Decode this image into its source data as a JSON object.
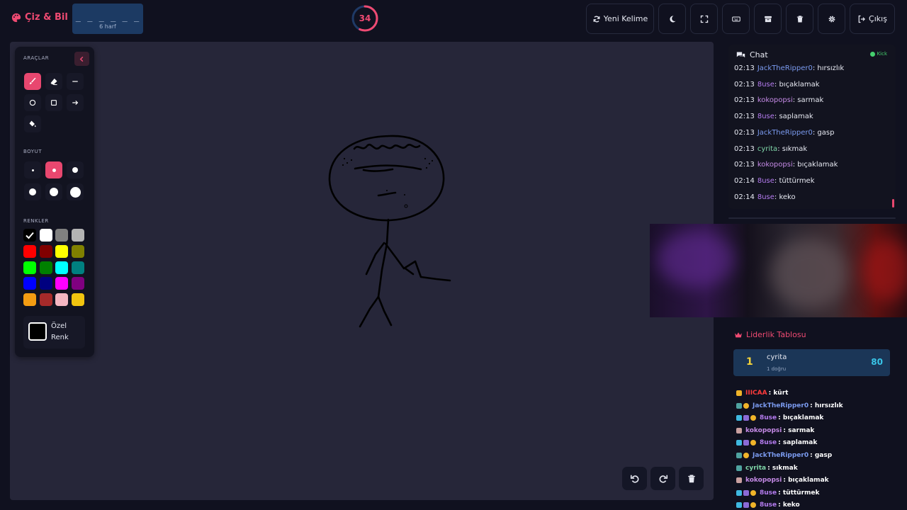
{
  "header": {
    "logo": "Çiz & Bil",
    "word_blanks": "_ _ _ _ _ _",
    "word_count": "6 harf",
    "timer": "34",
    "timer_progress": 0.57,
    "new_word_label": "Yeni Kelime",
    "exit_label": "Çıkış"
  },
  "tools": {
    "title": "ARAÇLAR",
    "size_title": "BOYUT",
    "colors_title": "RENKLER",
    "custom_color_label": "Özel Renk",
    "active_tool": "brush",
    "active_size": 2,
    "selected_color": "#000000",
    "palette": [
      "#000000",
      "#ffffff",
      "#808080",
      "#b4b4b4",
      "#ff0000",
      "#800000",
      "#ffff00",
      "#808000",
      "#00ff00",
      "#008000",
      "#00ffff",
      "#008080",
      "#0000ff",
      "#000080",
      "#ff00ff",
      "#800080",
      "#f39c12",
      "#a52a2a",
      "#f4b6c2",
      "#f1c40f"
    ]
  },
  "chat": {
    "title": "Chat",
    "platform": "Kick",
    "messages": [
      {
        "time": "02:13",
        "user": "JackTheRipper0",
        "color": "#7b9bf0",
        "text": ": hırsızlık"
      },
      {
        "time": "02:13",
        "user": "8use",
        "color": "#b57cf0",
        "text": ": bıçaklamak"
      },
      {
        "time": "02:13",
        "user": "kokopopsi",
        "color": "#c58ae6",
        "text": ": sarmak"
      },
      {
        "time": "02:13",
        "user": "8use",
        "color": "#b57cf0",
        "text": ": saplamak"
      },
      {
        "time": "02:13",
        "user": "JackTheRipper0",
        "color": "#7b9bf0",
        "text": ": gasp"
      },
      {
        "time": "02:13",
        "user": "cyrita",
        "color": "#7fd6a8",
        "text": ": sıkmak"
      },
      {
        "time": "02:13",
        "user": "kokopopsi",
        "color": "#c58ae6",
        "text": ": bıçaklamak"
      },
      {
        "time": "02:14",
        "user": "8use",
        "color": "#b57cf0",
        "text": ": tüttürmek"
      },
      {
        "time": "02:14",
        "user": "8use",
        "color": "#b57cf0",
        "text": ": keko"
      }
    ]
  },
  "leaderboard": {
    "title": "Liderlik Tablosu",
    "entries": [
      {
        "rank": "1",
        "name": "cyrita",
        "sub": "1 doğru",
        "score": "80"
      }
    ]
  },
  "feed": [
    {
      "user": "IIICAA",
      "color": "#ff3b3b",
      "text": " : kürt",
      "badges": [
        "#f0b429"
      ]
    },
    {
      "user": "JackTheRipper0",
      "color": "#7b9bf0",
      "text": " : hırsızlık",
      "badges": [
        "#4fa3a0",
        "#f0b429"
      ]
    },
    {
      "user": "8use",
      "color": "#b57cf0",
      "text": " : bıçaklamak",
      "badges": [
        "#3fb9e0",
        "#8a6ad6",
        "#f0b429"
      ]
    },
    {
      "user": "kokopopsi",
      "color": "#c58ae6",
      "text": " : sarmak",
      "badges": [
        "#c9a0a0"
      ]
    },
    {
      "user": "8use",
      "color": "#b57cf0",
      "text": " : saplamak",
      "badges": [
        "#3fb9e0",
        "#8a6ad6",
        "#f0b429"
      ]
    },
    {
      "user": "JackTheRipper0",
      "color": "#7b9bf0",
      "text": " : gasp",
      "badges": [
        "#4fa3a0",
        "#f0b429"
      ]
    },
    {
      "user": "cyrita",
      "color": "#7fd6a8",
      "text": " : sıkmak",
      "badges": [
        "#4fa3a0"
      ]
    },
    {
      "user": "kokopopsi",
      "color": "#c58ae6",
      "text": " : bıçaklamak",
      "badges": [
        "#c9a0a0"
      ]
    },
    {
      "user": "8use",
      "color": "#b57cf0",
      "text": " : tüttürmek",
      "badges": [
        "#3fb9e0",
        "#8a6ad6",
        "#f0b429"
      ]
    },
    {
      "user": "8use",
      "color": "#b57cf0",
      "text": " : keko",
      "badges": [
        "#3fb9e0",
        "#8a6ad6",
        "#f0b429"
      ]
    }
  ],
  "icons": {
    "logo": "palette-icon",
    "new_word": "refresh-icon",
    "theme": "moon-icon",
    "fullscreen": "expand-icon",
    "keyboard": "keyboard-icon",
    "archive": "archive-icon",
    "trash": "trash-icon",
    "settings": "gear-icon",
    "exit": "logout-icon",
    "chat": "comments-icon",
    "leaderboard": "crown-icon"
  }
}
